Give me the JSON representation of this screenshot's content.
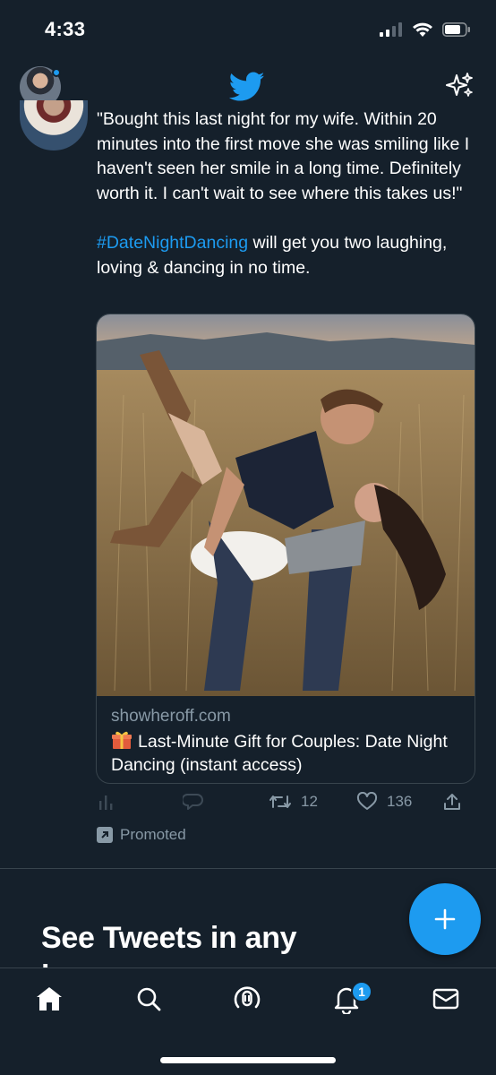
{
  "status_bar": {
    "time": "4:33",
    "icons": [
      "cellular-signal-icon",
      "wifi-icon",
      "battery-icon"
    ]
  },
  "header": {
    "logo": "twitter-bird-icon",
    "right_icon": "sparkle-icon"
  },
  "tweet": {
    "text_quote": "\"Bought this last night for my wife. Within 20 minutes into the first move she was smiling like I haven't seen her smile in a long time. Definitely worth it. I can't wait to see where this takes us!\"",
    "hashtag": "#DateNightDancing",
    "text_tail": " will get you two laughing, loving & dancing in no time.",
    "card": {
      "image": "couple-dancing-in-field-photo",
      "domain": "showheroff.com",
      "title": "Last-Minute Gift for Couples: Date Night Dancing (instant access)",
      "title_icon": "gift-emoji"
    },
    "actions": {
      "retweets": "12",
      "likes": "136"
    },
    "promoted_label": "Promoted"
  },
  "section": {
    "heading_line1": "See Tweets in any",
    "heading_line2": "l"
  },
  "nav": {
    "items": [
      "home-icon",
      "search-icon",
      "spaces-icon",
      "notifications-icon",
      "messages-icon"
    ],
    "notifications_badge": "1"
  },
  "colors": {
    "background": "#15202b",
    "accent": "#1d9bf0",
    "muted_text": "#8899a6",
    "border": "#38444d"
  }
}
